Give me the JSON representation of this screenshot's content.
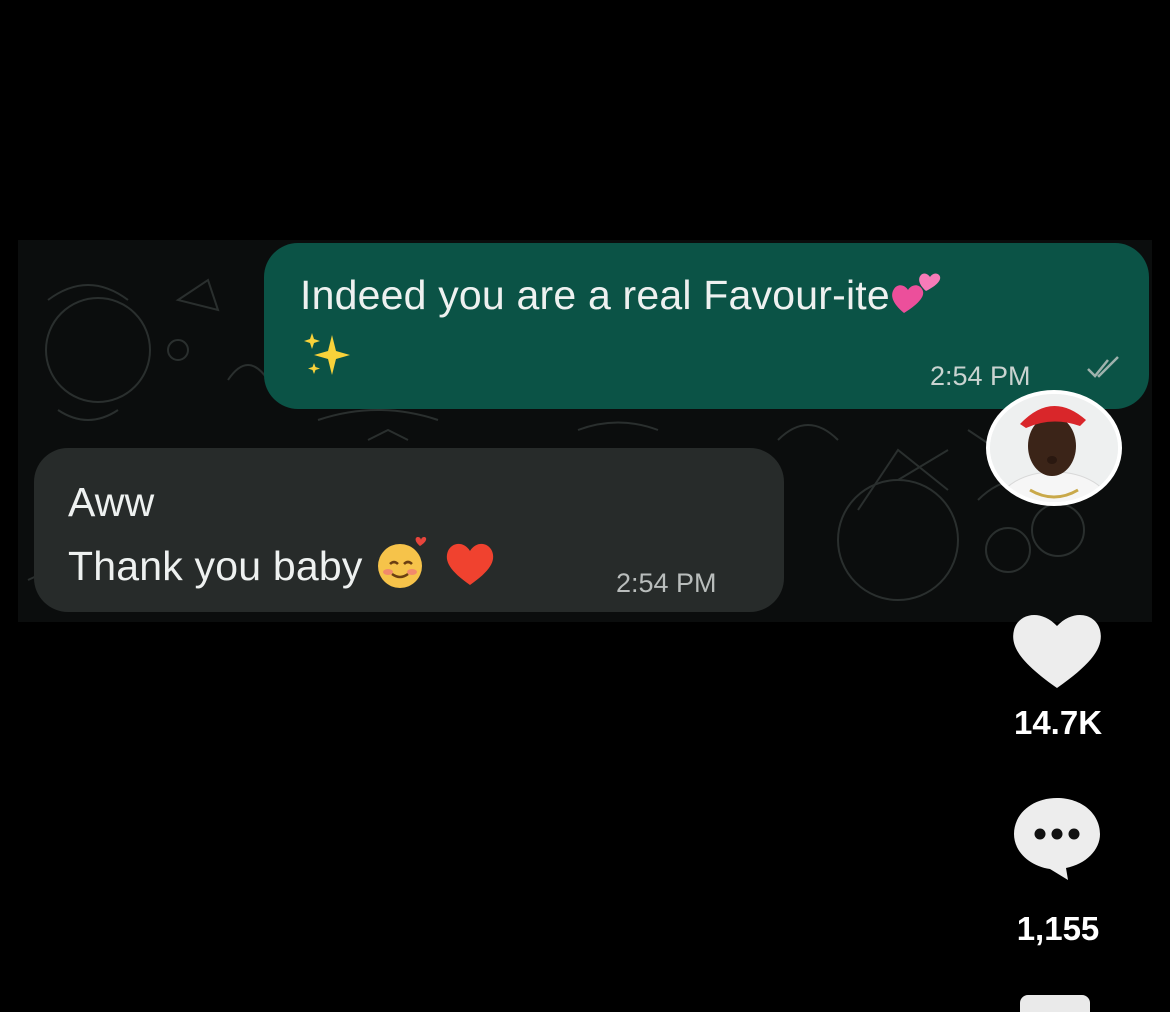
{
  "chat": {
    "outgoing": {
      "line1": "Indeed you are a real Favour-ite",
      "emoji_after_line1": "two-hearts-emoji",
      "line2_emoji": "sparkles-emoji",
      "time": "2:54 PM",
      "status_icon": "double-check-icon"
    },
    "incoming": {
      "line1": "Aww",
      "line2": "Thank you baby",
      "emojis": [
        "smiling-face-with-hearts-emoji",
        "red-heart-emoji"
      ],
      "time": "2:54 PM"
    },
    "colors": {
      "outgoing_bubble": "#0b5346",
      "incoming_bubble": "#272b2a",
      "background": "#000000"
    }
  },
  "rail": {
    "avatar": "creator-avatar",
    "like_icon": "heart-icon",
    "like_count": "14.7K",
    "comment_icon": "comment-icon",
    "comment_count": "1,155",
    "bookmark_icon": "bookmark-icon"
  }
}
